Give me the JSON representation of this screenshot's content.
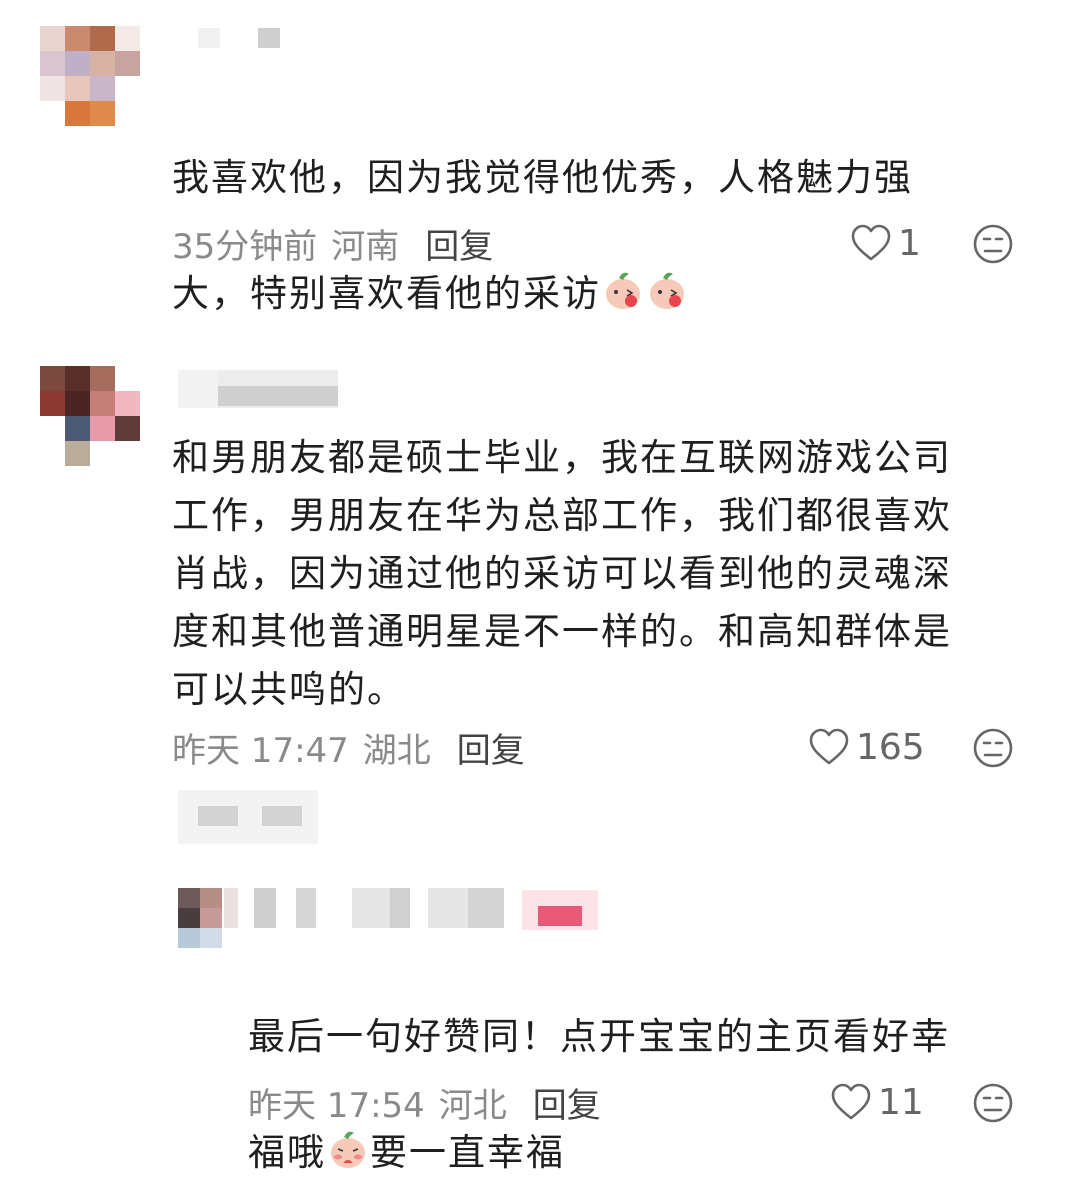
{
  "comments": [
    {
      "text_line1": "我喜欢他，因为我觉得他优秀，人格魅力强",
      "text_line2": "大，特别喜欢看他的采访",
      "time": "35分钟前",
      "location": "河南",
      "reply_label": "回复",
      "likes": "1"
    },
    {
      "text": "和男朋友都是硕士毕业，我在互联网游戏公司\n工作，男朋友在华为总部工作，我们都很喜欢\n肖战，因为通过他的采访可以看到他的灵魂深\n度和其他普通明星是不一样的。和高知群体是\n可以共鸣的。",
      "time": "昨天 17:47",
      "location": "湖北",
      "reply_label": "回复",
      "likes": "165"
    },
    {
      "text_line1": "最后一句好赞同！点开宝宝的主页看好幸",
      "text_line2_a": "福哦",
      "text_line2_b": "要一直幸福",
      "time": "昨天 17:54",
      "location": "河北",
      "reply_label": "回复",
      "likes": "11"
    }
  ],
  "icons": {
    "like": "heart-outline-icon",
    "dislike": "meh-face-icon",
    "emoji": "peach-blush-emoji"
  },
  "colors": {
    "text": "#1f1f1f",
    "meta": "#8a8a8a",
    "icon": "#666666"
  }
}
